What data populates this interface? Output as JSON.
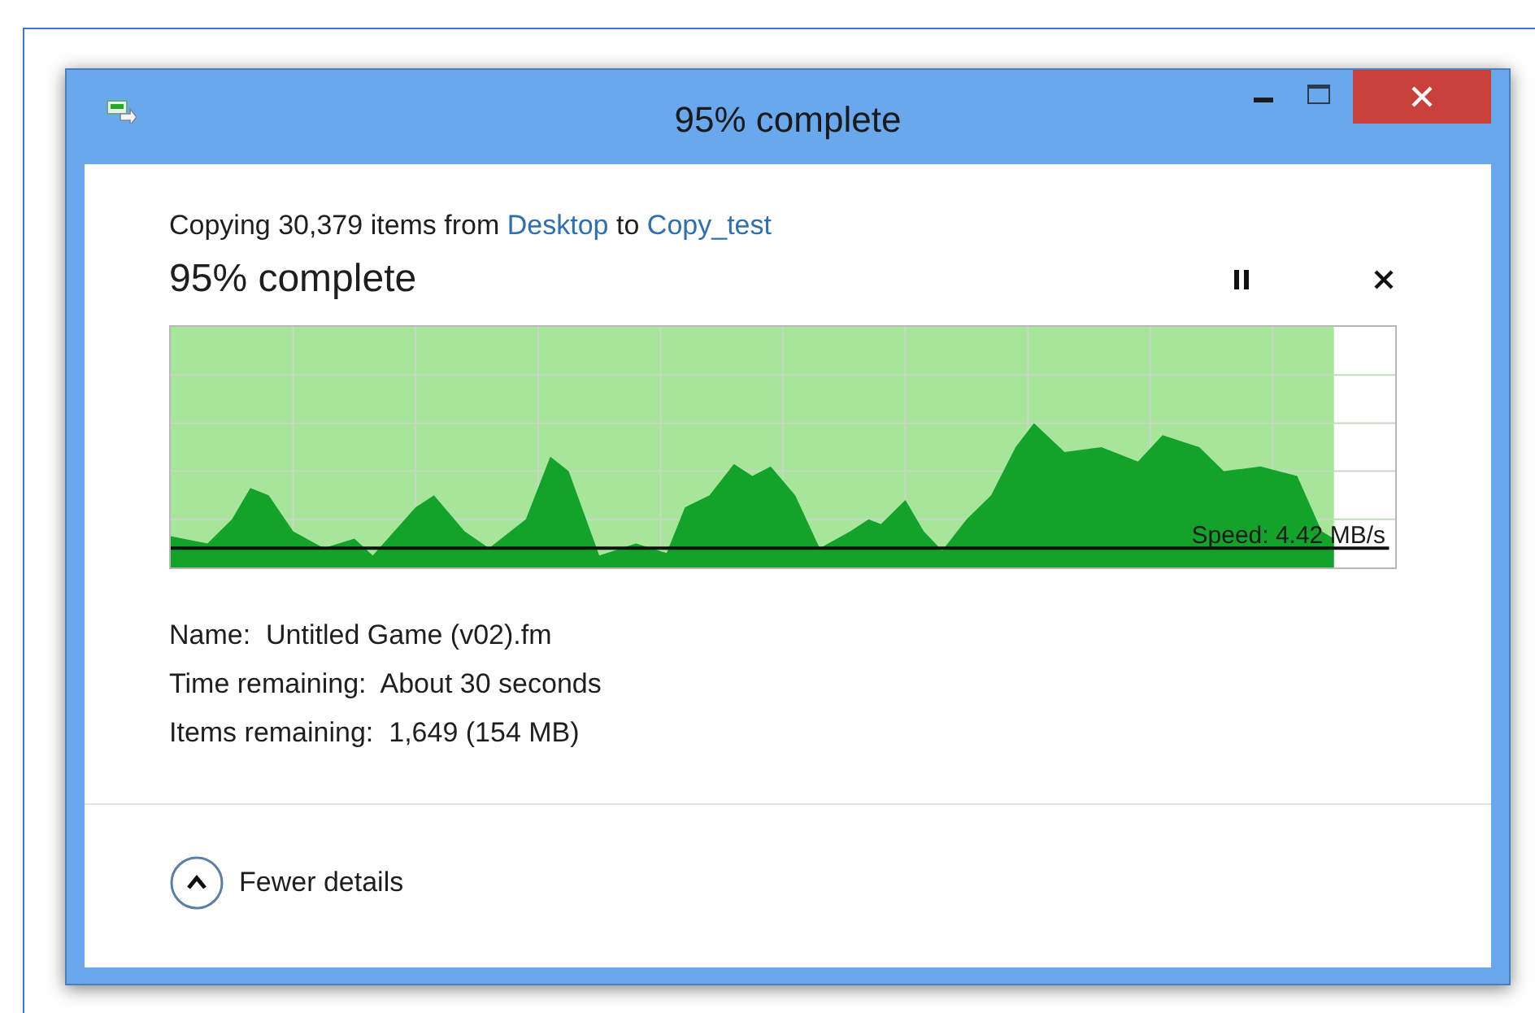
{
  "window": {
    "title": "95% complete"
  },
  "copy_summary": {
    "prefix": "Copying 30,379 items from",
    "source": "Desktop",
    "middle": "to",
    "destination": "Copy_test"
  },
  "progress": {
    "heading": "95% complete",
    "level": 0.95,
    "speed_label": "Speed: 4.42 MB/s"
  },
  "details": [
    {
      "label": "Name:",
      "value": "Untitled Game (v02).fm"
    },
    {
      "label": "Time remaining:",
      "value": "About 30 seconds"
    },
    {
      "label": "Items remaining:",
      "value": "1,649 (154 MB)"
    }
  ],
  "toggle": {
    "label": "Fewer details",
    "expanded": true
  }
}
